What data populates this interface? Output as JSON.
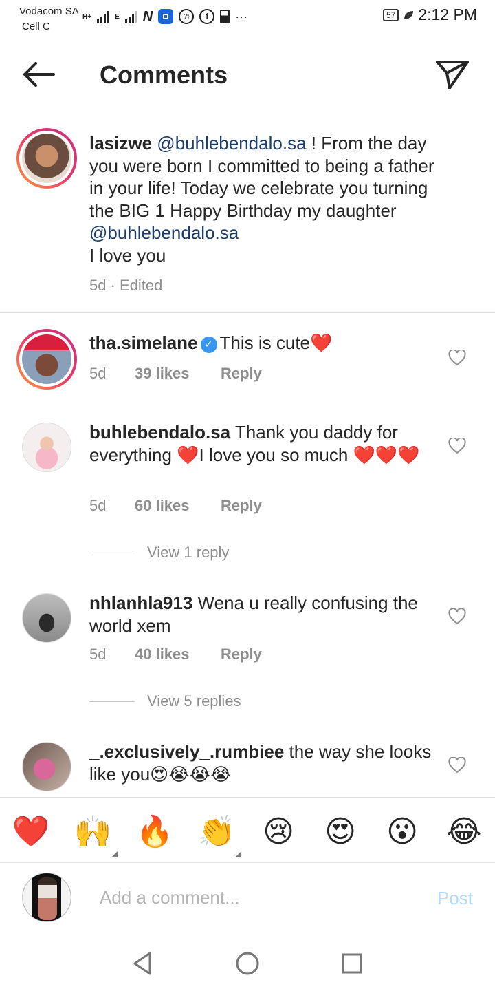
{
  "status_bar": {
    "carrier_1": "Vodacom SA",
    "carrier_2": "Cell C",
    "net_1": "H+",
    "net_2": "E",
    "more": "···",
    "battery": "57",
    "time": "2:12 PM"
  },
  "header": {
    "title": "Comments"
  },
  "caption": {
    "username": "lasizwe",
    "mention_1": "@buhlebendalo.sa",
    "text_1": " ! From the day you were born I committed to being a father in your life! Today we celebrate you turning the BIG 1 Happy Birthday my daughter ",
    "mention_2": "@buhlebendalo.sa",
    "text_2": "I love you",
    "meta": "5d · Edited"
  },
  "comments": [
    {
      "username": "tha.simelane",
      "verified": true,
      "text": "This is cute❤️",
      "time": "5d",
      "likes": "39 likes",
      "reply": "Reply"
    },
    {
      "username": "buhlebendalo.sa",
      "text": "Thank you daddy for everything ❤️I love you so much ❤️❤️❤️",
      "time": "5d",
      "likes": "60 likes",
      "reply": "Reply",
      "view_replies": "View 1 reply"
    },
    {
      "username": "nhlanhla913",
      "text": "Wena u really confusing the world xem",
      "time": "5d",
      "likes": "40 likes",
      "reply": "Reply",
      "view_replies": "View 5 replies"
    },
    {
      "username": "_.exclusively_.rumbiee",
      "text": "the way she looks like you😍😭😭😭"
    }
  ],
  "emoji_bar": [
    "❤️",
    "🙌",
    "🔥",
    "👏",
    "😢",
    "😍",
    "😮",
    "😂"
  ],
  "add_comment": {
    "placeholder": "Add a comment...",
    "post_label": "Post"
  },
  "colors": {
    "link": "#1b3d70",
    "meta": "#8e8e8e",
    "post_disabled": "#b3dbff",
    "verified": "#3897f0"
  }
}
